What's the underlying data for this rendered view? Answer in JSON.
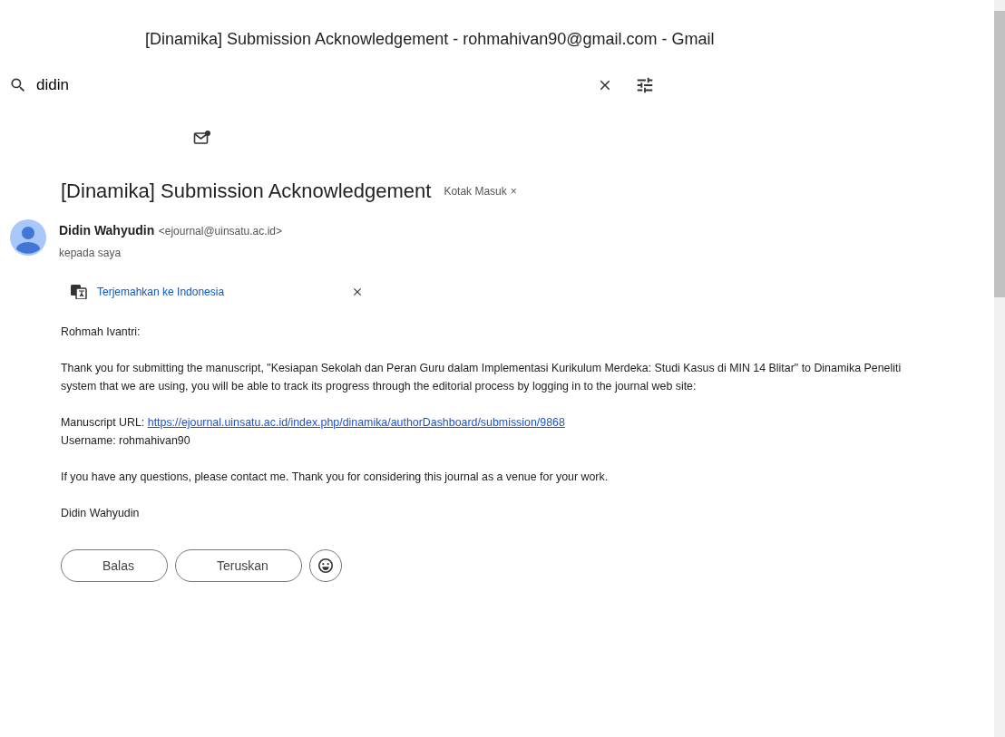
{
  "window": {
    "title": "[Dinamika] Submission Acknowledgement - rohmahivan90@gmail.com - Gmail"
  },
  "search": {
    "value": "didin"
  },
  "message": {
    "subject": "[Dinamika] Submission Acknowledgement",
    "label": "Kotak Masuk",
    "label_close": "×",
    "sender_name": "Didin Wahyudin",
    "sender_email": "<ejournal@uinsatu.ac.id>",
    "recipient": "kepada saya",
    "translate": "Terjemahkan ke Indonesia",
    "body": [
      {
        "kind": "text",
        "lines": [
          "Rohmah Ivantri:"
        ]
      },
      {
        "kind": "text",
        "lines": [
          "Thank you for submitting the manuscript, \"Kesiapan Sekolah dan Peran Guru dalam Implementasi Kurikulum Merdeka: Studi Kasus di MIN 14 Blitar\" to Dinamika Peneliti",
          "system that we are using, you will be able to track its progress through the editorial process by logging in to the journal web site:"
        ]
      },
      {
        "kind": "link",
        "label": "Manuscript URL:",
        "url": "https://ejournal.uinsatu.ac.id/index.php/dinamika/authorDashboard/submission/9868",
        "after": "Username: rohmahivan90"
      },
      {
        "kind": "text",
        "lines": [
          "If you have any questions, please contact me. Thank you for considering this journal as a venue for your work."
        ]
      },
      {
        "kind": "text",
        "lines": [
          "Didin Wahyudin"
        ]
      }
    ],
    "actions": [
      "Balas",
      "Teruskan"
    ]
  }
}
